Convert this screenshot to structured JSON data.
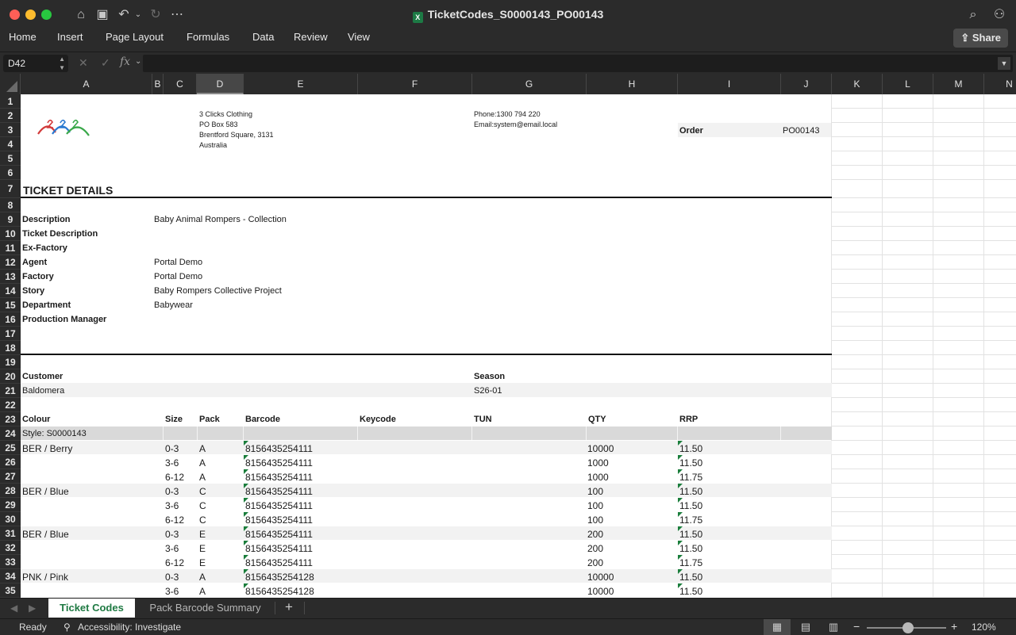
{
  "window": {
    "title": "TicketCodes_S0000143_PO00143"
  },
  "ribbon": {
    "tabs": [
      "Home",
      "Insert",
      "Page Layout",
      "Formulas",
      "Data",
      "Review",
      "View"
    ],
    "share_label": "Share"
  },
  "formula_bar": {
    "name_box": "D42",
    "fx_label": "fx",
    "content": ""
  },
  "columns": [
    "A",
    "B",
    "C",
    "D",
    "E",
    "F",
    "G",
    "H",
    "I",
    "J",
    "K",
    "L",
    "M",
    "N"
  ],
  "selected_column": "D",
  "rows": [
    "1",
    "2",
    "3",
    "4",
    "5",
    "6",
    "7",
    "8",
    "9",
    "10",
    "11",
    "12",
    "13",
    "14",
    "15",
    "16",
    "17",
    "18",
    "19",
    "20",
    "21",
    "22",
    "23",
    "24",
    "25",
    "26",
    "27",
    "28",
    "29",
    "30",
    "31",
    "32",
    "33",
    "34",
    "35"
  ],
  "sheet": {
    "company": {
      "name": "3 Clicks Clothing",
      "address1": "PO Box 583",
      "address2": "Brentford Square, 3131",
      "country": "Australia",
      "phone": "Phone:1300 794 220",
      "email": "Email:system@email.local"
    },
    "order_label": "Order",
    "order_value": "PO00143",
    "heading": "TICKET DETAILS",
    "details": [
      {
        "label": "Description",
        "value": "Baby Animal Rompers - Collection"
      },
      {
        "label": "Ticket Description",
        "value": ""
      },
      {
        "label": "Ex-Factory",
        "value": ""
      },
      {
        "label": "Agent",
        "value": "Portal Demo"
      },
      {
        "label": "Factory",
        "value": "Portal Demo"
      },
      {
        "label": "Story",
        "value": "Baby Rompers Collective Project"
      },
      {
        "label": "Department",
        "value": "Babywear"
      },
      {
        "label": "Production Manager",
        "value": ""
      }
    ],
    "customer_label": "Customer",
    "customer_value": "Baldomera",
    "season_label": "Season",
    "season_value": "S26-01",
    "table_headers": [
      "Colour",
      "Size",
      "Pack",
      "Barcode",
      "Keycode",
      "TUN",
      "QTY",
      "RRP"
    ],
    "style_row": "Style: S0000143",
    "items": [
      {
        "colour": "BER / Berry",
        "size": "0-3",
        "pack": "A",
        "barcode": "8156435254111",
        "qty": "10000",
        "rrp": "11.50"
      },
      {
        "colour": "",
        "size": "3-6",
        "pack": "A",
        "barcode": "8156435254111",
        "qty": "1000",
        "rrp": "11.50"
      },
      {
        "colour": "",
        "size": "6-12",
        "pack": "A",
        "barcode": "8156435254111",
        "qty": "1000",
        "rrp": "11.75"
      },
      {
        "colour": "BER / Blue",
        "size": "0-3",
        "pack": "C",
        "barcode": "8156435254111",
        "qty": "100",
        "rrp": "11.50"
      },
      {
        "colour": "",
        "size": "3-6",
        "pack": "C",
        "barcode": "8156435254111",
        "qty": "100",
        "rrp": "11.50"
      },
      {
        "colour": "",
        "size": "6-12",
        "pack": "C",
        "barcode": "8156435254111",
        "qty": "100",
        "rrp": "11.75"
      },
      {
        "colour": "BER / Blue",
        "size": "0-3",
        "pack": "E",
        "barcode": "8156435254111",
        "qty": "200",
        "rrp": "11.50"
      },
      {
        "colour": "",
        "size": "3-6",
        "pack": "E",
        "barcode": "8156435254111",
        "qty": "200",
        "rrp": "11.50"
      },
      {
        "colour": "",
        "size": "6-12",
        "pack": "E",
        "barcode": "8156435254111",
        "qty": "200",
        "rrp": "11.75"
      },
      {
        "colour": "PNK / Pink",
        "size": "0-3",
        "pack": "A",
        "barcode": "8156435254128",
        "qty": "10000",
        "rrp": "11.50"
      },
      {
        "colour": "",
        "size": "3-6",
        "pack": "A",
        "barcode": "8156435254128",
        "qty": "10000",
        "rrp": "11.50"
      }
    ]
  },
  "sheet_tabs": [
    "Ticket Codes",
    "Pack Barcode Summary"
  ],
  "active_sheet": "Ticket Codes",
  "status_bar": {
    "ready": "Ready",
    "accessibility": "Accessibility: Investigate",
    "zoom": "120%"
  },
  "colors": {
    "accent": "#1f7a43",
    "comment_marker": "#1b7e3c"
  }
}
